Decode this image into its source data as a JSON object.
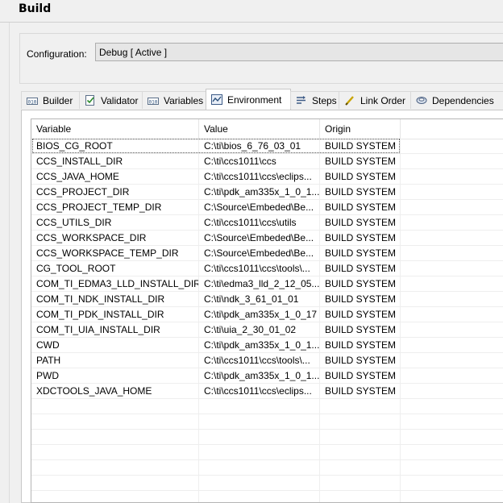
{
  "window": {
    "title": "Build"
  },
  "configuration": {
    "label": "Configuration:",
    "value": "Debug  [ Active ]"
  },
  "tabs": [
    {
      "label": "Builder",
      "icon": "builder-icon"
    },
    {
      "label": "Validator",
      "icon": "validator-icon"
    },
    {
      "label": "Variables",
      "icon": "variables-icon"
    },
    {
      "label": "Environment",
      "icon": "environment-icon",
      "active": true
    },
    {
      "label": "Steps",
      "icon": "steps-icon"
    },
    {
      "label": "Link Order",
      "icon": "link-order-icon"
    },
    {
      "label": "Dependencies",
      "icon": "dependencies-icon"
    }
  ],
  "table": {
    "columns": [
      "Variable",
      "Value",
      "Origin"
    ],
    "rows": [
      [
        "BIOS_CG_ROOT",
        "C:\\ti\\bios_6_76_03_01",
        "BUILD SYSTEM"
      ],
      [
        "CCS_INSTALL_DIR",
        "C:\\ti\\ccs1011\\ccs",
        "BUILD SYSTEM"
      ],
      [
        "CCS_JAVA_HOME",
        "C:\\ti\\ccs1011\\ccs\\eclips...",
        "BUILD SYSTEM"
      ],
      [
        "CCS_PROJECT_DIR",
        "C:\\ti\\pdk_am335x_1_0_1...",
        "BUILD SYSTEM"
      ],
      [
        "CCS_PROJECT_TEMP_DIR",
        "C:\\Source\\Embeded\\Be...",
        "BUILD SYSTEM"
      ],
      [
        "CCS_UTILS_DIR",
        "C:\\ti\\ccs1011\\ccs\\utils",
        "BUILD SYSTEM"
      ],
      [
        "CCS_WORKSPACE_DIR",
        "C:\\Source\\Embeded\\Be...",
        "BUILD SYSTEM"
      ],
      [
        "CCS_WORKSPACE_TEMP_DIR",
        "C:\\Source\\Embeded\\Be...",
        "BUILD SYSTEM"
      ],
      [
        "CG_TOOL_ROOT",
        "C:\\ti\\ccs1011\\ccs\\tools\\...",
        "BUILD SYSTEM"
      ],
      [
        "COM_TI_EDMA3_LLD_INSTALL_DIR",
        "C:\\ti\\edma3_lld_2_12_05...",
        "BUILD SYSTEM"
      ],
      [
        "COM_TI_NDK_INSTALL_DIR",
        "C:\\ti\\ndk_3_61_01_01",
        "BUILD SYSTEM"
      ],
      [
        "COM_TI_PDK_INSTALL_DIR",
        "C:\\ti\\pdk_am335x_1_0_17",
        "BUILD SYSTEM"
      ],
      [
        "COM_TI_UIA_INSTALL_DIR",
        "C:\\ti\\uia_2_30_01_02",
        "BUILD SYSTEM"
      ],
      [
        "CWD",
        "C:\\ti\\pdk_am335x_1_0_1...",
        "BUILD SYSTEM"
      ],
      [
        "PATH",
        "C:\\ti\\ccs1011\\ccs\\tools\\...",
        "BUILD SYSTEM"
      ],
      [
        "PWD",
        "C:\\ti\\pdk_am335x_1_0_1...",
        "BUILD SYSTEM"
      ],
      [
        "XDCTOOLS_JAVA_HOME",
        "C:\\ti\\ccs1011\\ccs\\eclips...",
        "BUILD SYSTEM"
      ]
    ],
    "selected_row": 0,
    "empty_rows": 8
  }
}
